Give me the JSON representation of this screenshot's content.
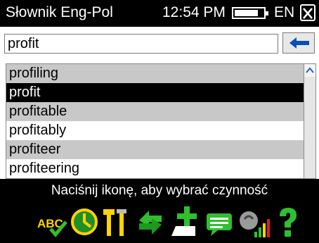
{
  "titlebar": {
    "app_title": "Słownik Eng-Pol",
    "time": "12:54 PM",
    "battery_level": 0.82,
    "language": "EN"
  },
  "search": {
    "value": "profit"
  },
  "word_list": {
    "items": [
      {
        "word": "profiling",
        "selected": false
      },
      {
        "word": "profit",
        "selected": true
      },
      {
        "word": "profitable",
        "selected": false
      },
      {
        "word": "profitably",
        "selected": false
      },
      {
        "word": "profiteer",
        "selected": false
      },
      {
        "word": "profiteering",
        "selected": false
      }
    ]
  },
  "status_text": "Naciśnij ikonę, aby wybrać czynność",
  "toolbar": {
    "icons": [
      "spellcheck-icon",
      "history-icon",
      "tools-icon",
      "swap-icon",
      "add-note-icon",
      "message-icon",
      "speaker-icon",
      "help-icon"
    ],
    "spellcheck_glyph": "ABC"
  },
  "colors": {
    "selection": "#000000",
    "row_alt": "#c8c8c8",
    "back_arrow": "#0a4fb8",
    "toolbar_icon": "#ffd400"
  }
}
